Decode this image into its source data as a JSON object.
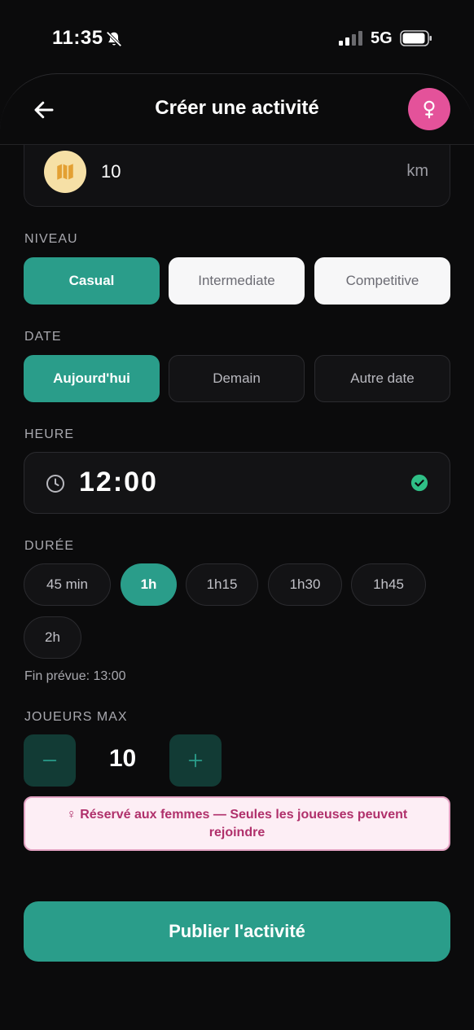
{
  "status": {
    "time": "11:35",
    "network": "5G"
  },
  "header": {
    "title": "Créer une activité"
  },
  "distance": {
    "value": "10",
    "unit": "km"
  },
  "level": {
    "label": "NIVEAU",
    "options": [
      "Casual",
      "Intermediate",
      "Competitive"
    ],
    "selected": "Casual"
  },
  "date": {
    "label": "DATE",
    "options": [
      "Aujourd'hui",
      "Demain",
      "Autre date"
    ],
    "selected": "Aujourd'hui"
  },
  "time": {
    "label": "HEURE",
    "value": "12:00"
  },
  "duration": {
    "label": "DURÉE",
    "options": [
      "45 min",
      "1h",
      "1h15",
      "1h30",
      "1h45",
      "2h"
    ],
    "selected": "1h",
    "end_text": "Fin prévue: 13:00"
  },
  "players": {
    "label": "JOUEURS MAX",
    "value": "10"
  },
  "notice": {
    "text": "♀ Réservé aux femmes — Seules les joueuses peuvent rejoindre"
  },
  "publish": {
    "label": "Publier l'activité"
  },
  "colors": {
    "accent": "#2a9d8a",
    "pink": "#e4529a",
    "background": "#0b0b0c"
  }
}
